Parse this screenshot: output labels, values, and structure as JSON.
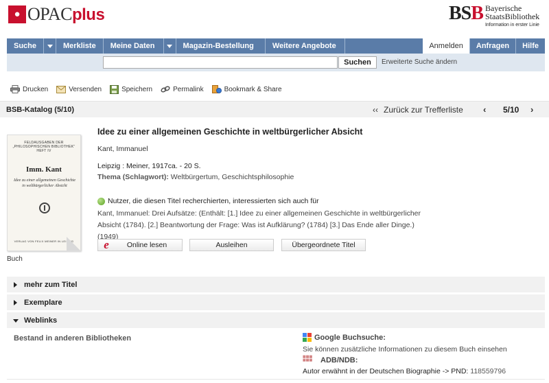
{
  "header": {
    "logo_opac": "OPAC",
    "logo_plus": "plus",
    "bsb_mark_1": "BS",
    "bsb_mark_2": "B",
    "bsb_line1": "Bayerische",
    "bsb_line2": "StaatsBibliothek",
    "bsb_tagline": "Information in erster Linie"
  },
  "nav": {
    "items": [
      "Suche",
      "Merkliste",
      "Meine Daten",
      "Magazin-Bestellung",
      "Weitere Angebote"
    ],
    "right": [
      "Anmelden",
      "Anfragen",
      "Hilfe"
    ]
  },
  "search": {
    "value": "",
    "button": "Suchen",
    "advanced": "Erweiterte Suche ändern"
  },
  "toolbar": {
    "print": "Drucken",
    "send": "Versenden",
    "save": "Speichern",
    "permalink": "Permalink",
    "bookmark": "Bookmark & Share"
  },
  "catalog": {
    "title": "BSB-Katalog (5/10)",
    "back_arrows": "‹‹",
    "back": "Zurück zur Trefferliste",
    "prev": "‹",
    "pager": "5/10",
    "next": "›"
  },
  "cover": {
    "series": "FELDAUSGABEN DER „PHILOSOPHISCHEN BIBLIOTHEK“ HEFT IV",
    "author": "Imm. Kant",
    "title": "Idee zu einer allgemeinen Geschichte in weltbürgerlicher Absicht",
    "publisher": "VERLAG VON FELIX MEINER IN LEIPZIG",
    "caption": "Buch"
  },
  "record": {
    "title": "Idee zu einer allgemeinen Geschichte in weltbürgerlicher Absicht",
    "author": "Kant, Immanuel",
    "imprint": "Leipzig : Meiner, 1917ca. - 20 S.",
    "subject_label": "Thema (Schlagwort):",
    "subject_value": "Weltbürgertum, Geschichtsphilosophie",
    "recommend_head": "Nutzer, die diesen Titel recherchierten, interessierten sich auch für",
    "recommend_line1": "Kant, Immanuel: Drei Aufsätze: (Enthält: [1.] Idee zu einer allgemeinen Geschichte in weltbürgerlicher",
    "recommend_line2": "Absicht (1784). [2.] Beantwortung der Frage: Was ist Aufklärung? (1784) [3.] Das Ende aller Dinge.) (1949)"
  },
  "actions": {
    "online": "Online lesen",
    "online_icon_letter": "e",
    "loan": "Ausleihen",
    "parent": "Übergeordnete Titel"
  },
  "accordion": {
    "more": "mehr zum Titel",
    "copies": "Exemplare",
    "weblinks": "Weblinks"
  },
  "weblinks": {
    "holdings": "Bestand in anderen Bibliotheken",
    "google_title": "Google Buchsuche:",
    "google_desc": "Sie können zusätzliche Informationen zu diesem Buch einsehen",
    "adb_title": "ADB/NDB:",
    "adb_desc": "Autor erwähnt in der Deutschen Biographie -> PND:",
    "adb_pnd": "118559796"
  },
  "colors": {
    "nav_bg": "#5a7ca8",
    "search_bg": "#dfe7f0",
    "brand_red": "#c8102e",
    "strip_bg": "#f1f1f1"
  }
}
